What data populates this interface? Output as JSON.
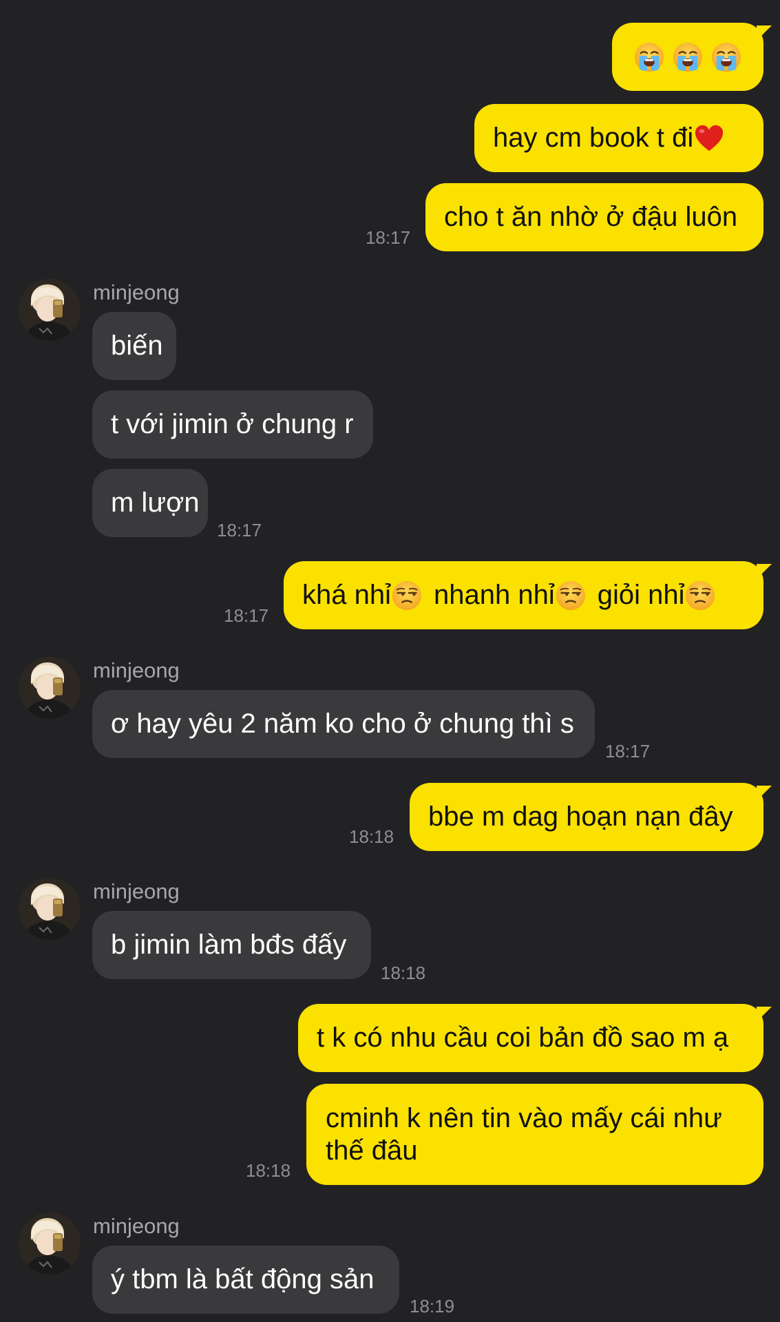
{
  "contact": {
    "name": "minjeong"
  },
  "emoji": {
    "crying": "loudly-crying-face-icon",
    "heart": "red-heart-icon",
    "unamused": "unamused-face-icon"
  },
  "colors": {
    "background": "#222224",
    "sent_bubble": "#fae100",
    "received_bubble": "#3a3a3c"
  },
  "messages": [
    {
      "from": "me",
      "text": ""
    },
    {
      "from": "me",
      "text": "hay cm book t đi"
    },
    {
      "from": "me",
      "text": "cho t ăn nhờ ở đậu luôn",
      "time": "18:17"
    },
    {
      "from": "minjeong",
      "text": "biến"
    },
    {
      "from": "minjeong",
      "text": "t với jimin ở chung r"
    },
    {
      "from": "minjeong",
      "text": "m lượn",
      "time": "18:17"
    },
    {
      "from": "me",
      "parts": [
        "khá nhỉ",
        "nhanh nhỉ",
        "giỏi nhỉ"
      ],
      "time": "18:17"
    },
    {
      "from": "minjeong",
      "text": "ơ hay yêu 2 năm ko cho ở chung thì s",
      "time": "18:17"
    },
    {
      "from": "me",
      "text": "bbe m dag hoạn nạn đây",
      "time": "18:18"
    },
    {
      "from": "minjeong",
      "text": "b jimin làm bđs đấy",
      "time": "18:18"
    },
    {
      "from": "me",
      "text": "t k có nhu cầu coi bản đồ sao m ạ"
    },
    {
      "from": "me",
      "text": "cminh k nên tin vào mấy cái như thế đâu",
      "time": "18:18"
    },
    {
      "from": "minjeong",
      "text": "ý tbm là bất động sản",
      "time": "18:19"
    }
  ]
}
